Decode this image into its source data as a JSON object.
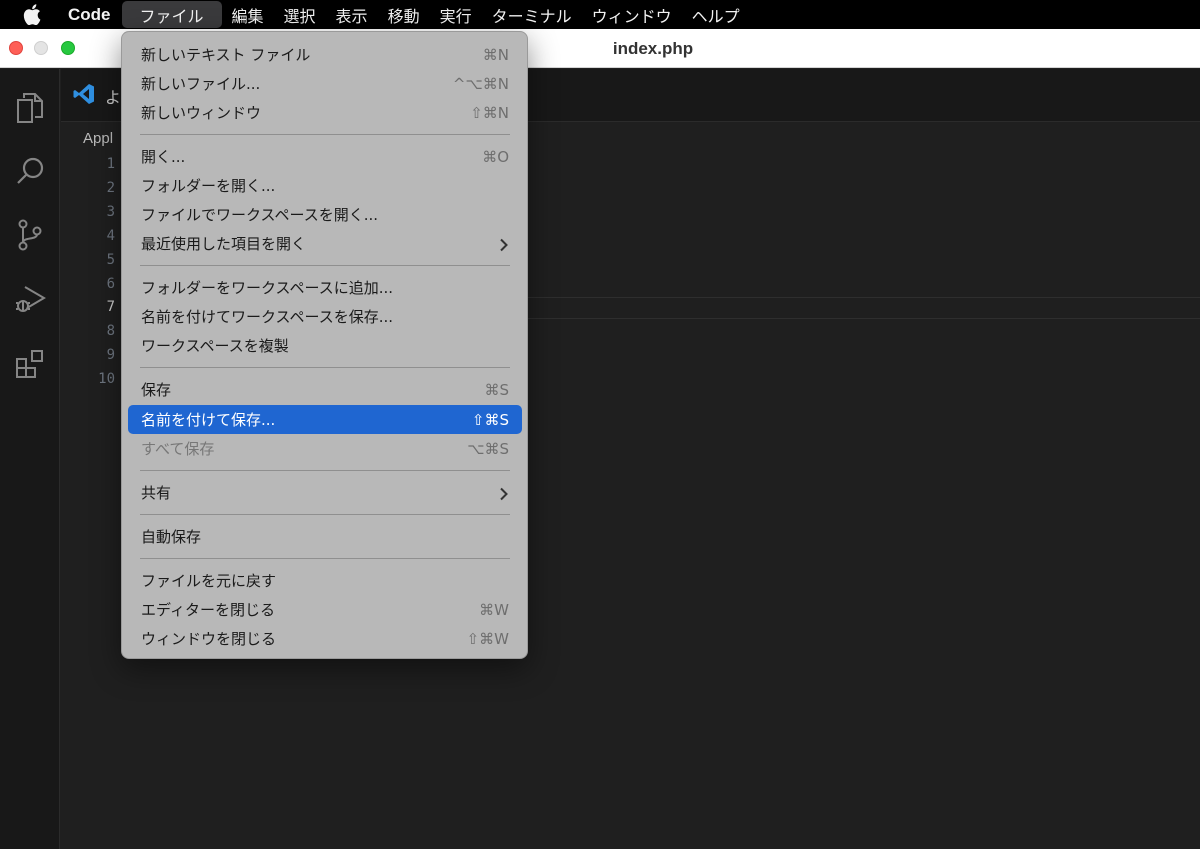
{
  "menubar": {
    "app": "Code",
    "items": [
      "ファイル",
      "編集",
      "選択",
      "表示",
      "移動",
      "実行",
      "ターミナル",
      "ウィンドウ",
      "ヘルプ"
    ]
  },
  "window": {
    "title": "index.php"
  },
  "tab": {
    "label": "よ"
  },
  "editor": {
    "breadcrumb": "Appl",
    "line_numbers": [
      "1",
      "2",
      "3",
      "4",
      "5",
      "6",
      "7",
      "8",
      "9",
      "10"
    ],
    "current_line": "7"
  },
  "file_menu": {
    "items": [
      {
        "label": "新しいテキスト ファイル",
        "shortcut": "⌘N"
      },
      {
        "label": "新しいファイル...",
        "shortcut": "^⌥⌘N"
      },
      {
        "label": "新しいウィンドウ",
        "shortcut": "⇧⌘N"
      },
      {
        "label": "開く...",
        "shortcut": "⌘O"
      },
      {
        "label": "フォルダーを開く...",
        "shortcut": ""
      },
      {
        "label": "ファイルでワークスペースを開く...",
        "shortcut": ""
      },
      {
        "label": "最近使用した項目を開く",
        "shortcut": "",
        "submenu": true
      },
      {
        "label": "フォルダーをワークスペースに追加...",
        "shortcut": ""
      },
      {
        "label": "名前を付けてワークスペースを保存...",
        "shortcut": ""
      },
      {
        "label": "ワークスペースを複製",
        "shortcut": ""
      },
      {
        "label": "保存",
        "shortcut": "⌘S"
      },
      {
        "label": "名前を付けて保存...",
        "shortcut": "⇧⌘S",
        "selected": true
      },
      {
        "label": "すべて保存",
        "shortcut": "⌥⌘S",
        "disabled": true
      },
      {
        "label": "共有",
        "shortcut": "",
        "submenu": true
      },
      {
        "label": "自動保存",
        "shortcut": ""
      },
      {
        "label": "ファイルを元に戻す",
        "shortcut": ""
      },
      {
        "label": "エディターを閉じる",
        "shortcut": "⌘W"
      },
      {
        "label": "ウィンドウを閉じる",
        "shortcut": "⇧⌘W"
      }
    ]
  },
  "colors": {
    "menu_highlight": "#1f66d1",
    "menu_background": "#b8b8b8",
    "editor_background": "#1f1f1f",
    "vscode_logo": "#2f8fe0"
  }
}
